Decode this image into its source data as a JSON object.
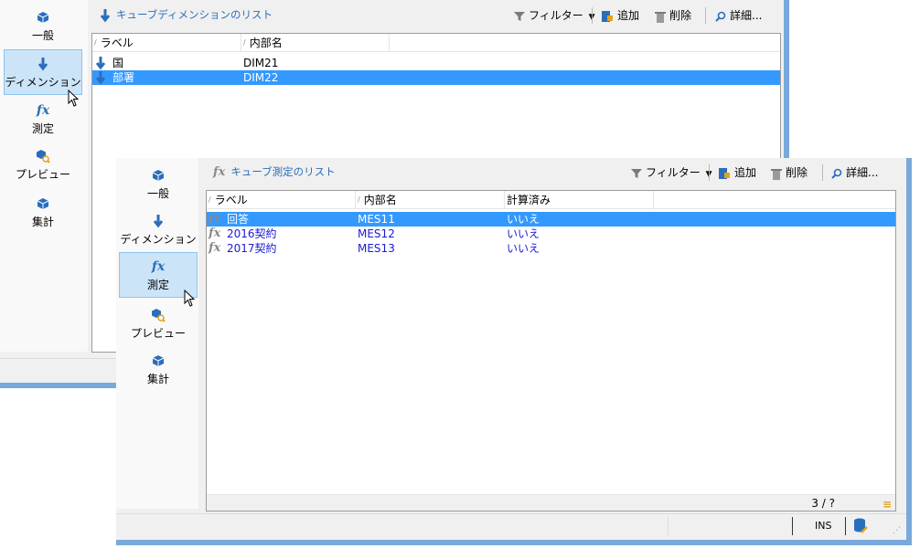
{
  "dim_window": {
    "sidebar": [
      {
        "label": "一般",
        "icon": "cube-icon"
      },
      {
        "label": "ディメンション",
        "icon": "down-arrow-icon"
      },
      {
        "label": "測定",
        "icon": "fx-icon"
      },
      {
        "label": "プレビュー",
        "icon": "preview-icon"
      },
      {
        "label": "集計",
        "icon": "cube-icon"
      }
    ],
    "title": "キューブディメンションのリスト",
    "toolbar": {
      "filter": "フィルター",
      "add": "追加",
      "delete": "削除",
      "details": "詳細..."
    },
    "columns": [
      "ラベル",
      "内部名"
    ],
    "rows": [
      {
        "label": "国",
        "name": "DIM21",
        "selected": false
      },
      {
        "label": "部署",
        "name": "DIM22",
        "selected": true
      }
    ]
  },
  "measure_window": {
    "sidebar": [
      {
        "label": "一般",
        "icon": "cube-icon"
      },
      {
        "label": "ディメンション",
        "icon": "down-arrow-icon"
      },
      {
        "label": "測定",
        "icon": "fx-icon"
      },
      {
        "label": "プレビュー",
        "icon": "preview-icon"
      },
      {
        "label": "集計",
        "icon": "cube-icon"
      }
    ],
    "title": "キューブ測定のリスト",
    "toolbar": {
      "filter": "フィルター",
      "add": "追加",
      "delete": "削除",
      "details": "詳細..."
    },
    "columns": [
      "ラベル",
      "内部名",
      "計算済み"
    ],
    "rows": [
      {
        "label": "回答",
        "name": "MES11",
        "computed": "いいえ",
        "selected": true
      },
      {
        "label": "2016契約",
        "name": "MES12",
        "computed": "いいえ",
        "selected": false
      },
      {
        "label": "2017契約",
        "name": "MES13",
        "computed": "いいえ",
        "selected": false
      }
    ],
    "pager": "3 / ?",
    "status_ins": "INS"
  },
  "colors": {
    "accent": "#2a6ebb",
    "selection": "#3399ff",
    "sidebar_selected": "#cce4f7",
    "window_border": "#78a9dc"
  }
}
